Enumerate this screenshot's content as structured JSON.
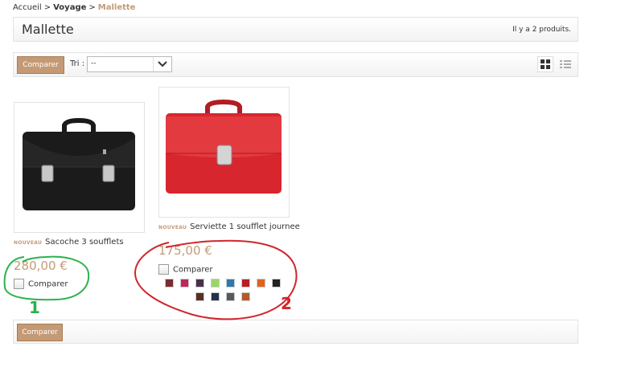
{
  "breadcrumb": {
    "home": "Accueil",
    "separator": ">",
    "category": "Voyage",
    "current": "Mallette"
  },
  "header": {
    "title": "Mallette",
    "product_count": "Il y a 2 produits."
  },
  "toolbar": {
    "compare_label": "Comparer",
    "sort_label": "Tri :",
    "sort_value": "--",
    "views": [
      "grid-view-icon",
      "list-view-icon"
    ],
    "active_view": "grid"
  },
  "products": [
    {
      "badge": "NOUVEAU",
      "name": "Sacoche 3 soufflets",
      "price": "280,00 €",
      "compare_label": "Comparer",
      "image_icon": "black-briefcase-image"
    },
    {
      "badge": "NOUVEAU",
      "name": "Serviette 1 soufflet journee",
      "price": "175,00 €",
      "compare_label": "Comparer",
      "image_icon": "red-briefcase-image",
      "swatches": [
        "#7a2b2f",
        "#c0275a",
        "#4a2f4a",
        "#99d66a",
        "#2f79b0",
        "#b52025",
        "#e0621c",
        "#222222",
        "#5a3025",
        "#233150",
        "#555a5f",
        "#b45a2b"
      ]
    }
  ],
  "footer": {
    "compare_label": "Comparer"
  },
  "annotations": [
    {
      "label": "1",
      "color": "#2bb24c"
    },
    {
      "label": "2",
      "color": "#d0262d"
    }
  ],
  "colors": {
    "accent": "#c39a74",
    "annotation_green": "#2bb24c",
    "annotation_red": "#d0262d"
  }
}
